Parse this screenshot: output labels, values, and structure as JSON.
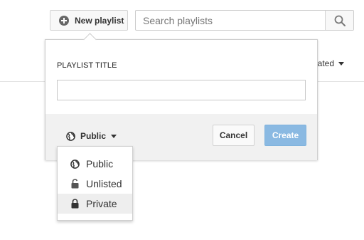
{
  "toolbar": {
    "new_playlist_label": "New playlist",
    "search_placeholder": "Search playlists",
    "sort_label": "eated"
  },
  "dialog": {
    "title_label": "PLAYLIST TITLE",
    "title_value": "",
    "privacy_selected": "Public",
    "cancel_label": "Cancel",
    "create_label": "Create",
    "create_color": "#8ab9e2"
  },
  "privacy_menu": {
    "items": [
      {
        "label": "Public",
        "icon": "globe-icon"
      },
      {
        "label": "Unlisted",
        "icon": "unlocked-icon"
      },
      {
        "label": "Private",
        "icon": "lock-icon"
      }
    ],
    "highlighted": "Private"
  }
}
